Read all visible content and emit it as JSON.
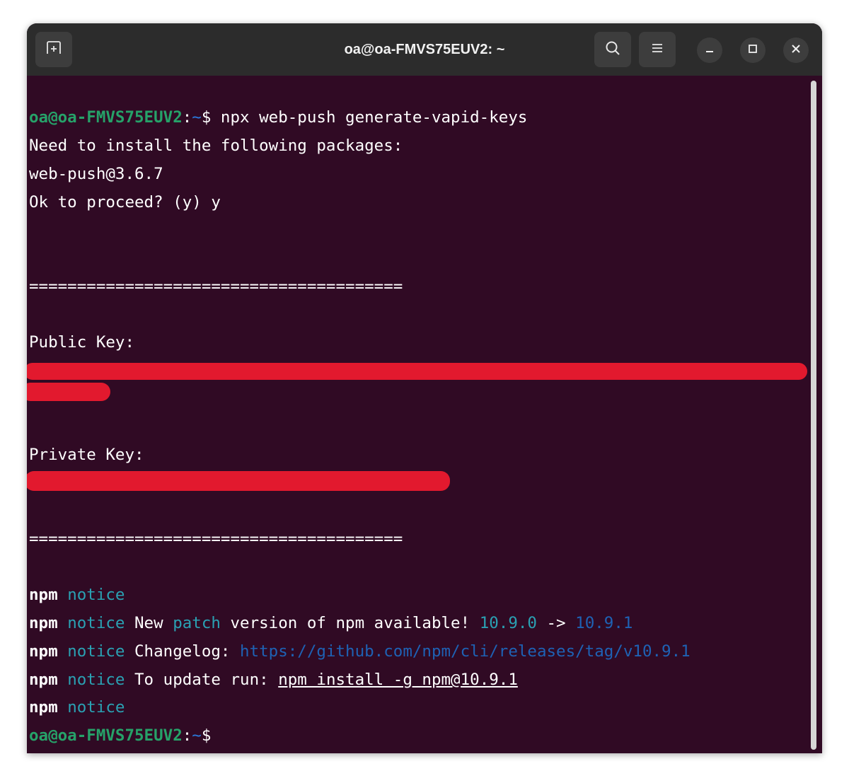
{
  "window": {
    "title": "oa@oa-FMVS75EUV2: ~"
  },
  "icons": {
    "new_tab": "new-tab-icon",
    "search": "search-icon",
    "menu": "hamburger-menu-icon",
    "minimize": "minimize-icon",
    "maximize": "maximize-icon",
    "close": "close-icon"
  },
  "colors": {
    "terminal_bg": "#300a24",
    "titlebar_bg": "#2c2c2c",
    "prompt_user": "#26a269",
    "prompt_path": "#2a7bde",
    "npm_notice": "#2aa1b3",
    "redaction": "#e2192e"
  },
  "terminal": {
    "prompt_user": "oa@oa-FMVS75EUV2",
    "prompt_colon": ":",
    "prompt_path": "~",
    "prompt_symbol": "$",
    "command": " npx web-push generate-vapid-keys",
    "lines": {
      "need_install": "Need to install the following packages:",
      "package": "web-push@3.6.7",
      "proceed": "Ok to proceed? (y) y",
      "separator1": "=======================================",
      "public_key_label": "Public Key:",
      "private_key_label": "Private Key:",
      "separator2": "======================================="
    },
    "npm": {
      "prefix": "npm",
      "notice": "notice",
      "new_label": " New ",
      "patch": "patch",
      "version_text": " version of npm available! ",
      "old_version": "10.9.0",
      "arrow": " -> ",
      "new_version": "10.9.1",
      "changelog_label": " Changelog: ",
      "changelog_url": "https://github.com/npm/cli/releases/tag/v10.9.1",
      "update_label": " To update run: ",
      "update_cmd": "npm install -g npm@10.9.1"
    }
  }
}
